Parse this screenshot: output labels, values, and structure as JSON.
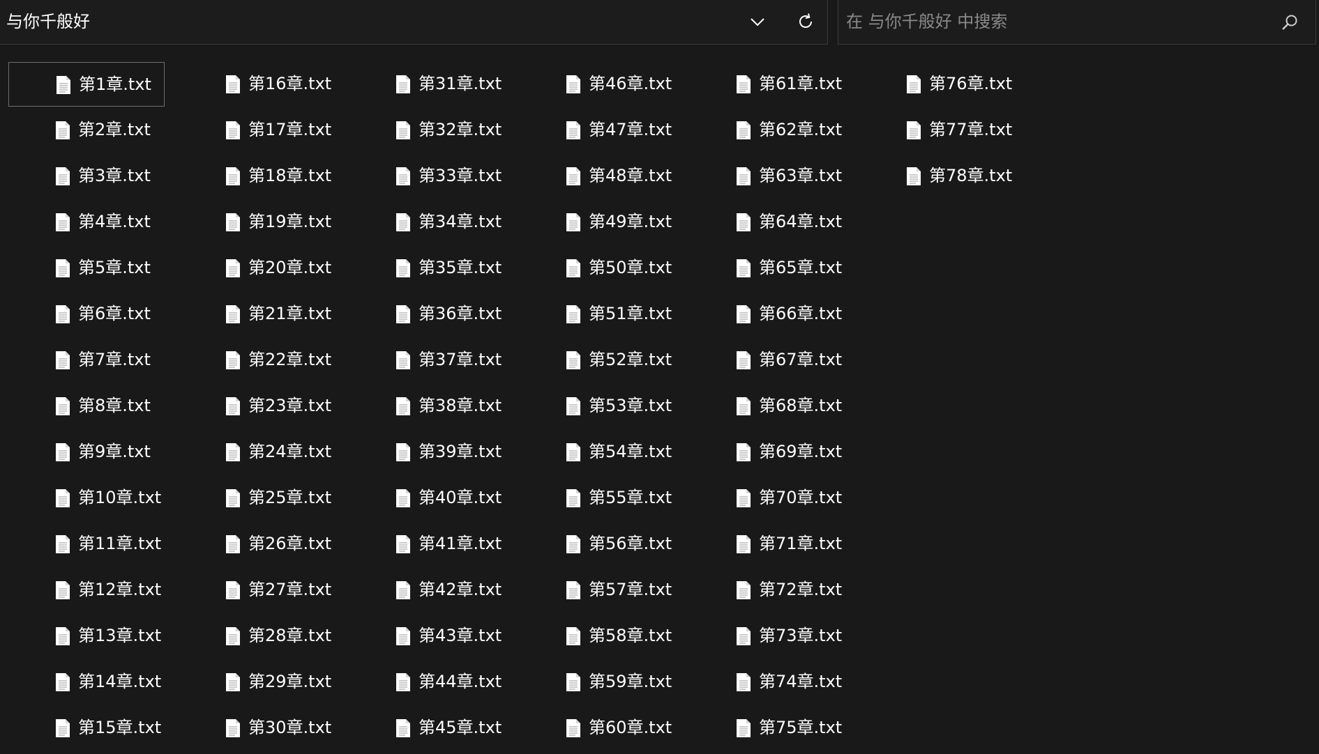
{
  "address_bar": {
    "path": "与你千般好",
    "dropdown_icon": "chevron-down-icon",
    "refresh_icon": "refresh-icon"
  },
  "search": {
    "placeholder": "在 与你千般好 中搜索",
    "value": "",
    "icon": "search-icon"
  },
  "files": [
    "第1章.txt",
    "第2章.txt",
    "第3章.txt",
    "第4章.txt",
    "第5章.txt",
    "第6章.txt",
    "第7章.txt",
    "第8章.txt",
    "第9章.txt",
    "第10章.txt",
    "第11章.txt",
    "第12章.txt",
    "第13章.txt",
    "第14章.txt",
    "第15章.txt",
    "第16章.txt",
    "第17章.txt",
    "第18章.txt",
    "第19章.txt",
    "第20章.txt",
    "第21章.txt",
    "第22章.txt",
    "第23章.txt",
    "第24章.txt",
    "第25章.txt",
    "第26章.txt",
    "第27章.txt",
    "第28章.txt",
    "第29章.txt",
    "第30章.txt",
    "第31章.txt",
    "第32章.txt",
    "第33章.txt",
    "第34章.txt",
    "第35章.txt",
    "第36章.txt",
    "第37章.txt",
    "第38章.txt",
    "第39章.txt",
    "第40章.txt",
    "第41章.txt",
    "第42章.txt",
    "第43章.txt",
    "第44章.txt",
    "第45章.txt",
    "第46章.txt",
    "第47章.txt",
    "第48章.txt",
    "第49章.txt",
    "第50章.txt",
    "第51章.txt",
    "第52章.txt",
    "第53章.txt",
    "第54章.txt",
    "第55章.txt",
    "第56章.txt",
    "第57章.txt",
    "第58章.txt",
    "第59章.txt",
    "第60章.txt",
    "第61章.txt",
    "第62章.txt",
    "第63章.txt",
    "第64章.txt",
    "第65章.txt",
    "第66章.txt",
    "第67章.txt",
    "第68章.txt",
    "第69章.txt",
    "第70章.txt",
    "第71章.txt",
    "第72章.txt",
    "第73章.txt",
    "第74章.txt",
    "第75章.txt",
    "第76章.txt",
    "第77章.txt",
    "第78章.txt"
  ],
  "file_icon": "text-document-icon",
  "selected_file": "第1章.txt",
  "colors": {
    "background": "#191919",
    "text": "#ffffff",
    "placeholder": "#8a8a8a",
    "border": "#3a3a3a",
    "selection_border": "#6e6e6e"
  }
}
